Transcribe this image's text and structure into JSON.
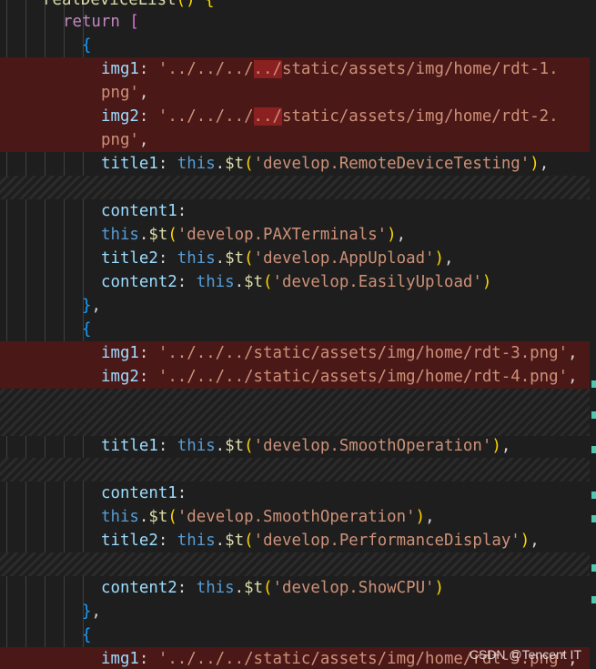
{
  "lines": {
    "l0": {
      "name": "realDeviceList",
      "parens": "()",
      "brace": "{"
    },
    "l1": {
      "kw": "return",
      "bracket": "["
    },
    "l2": {
      "brace": "{"
    },
    "l3": {
      "key": "img1",
      "colon": ": ",
      "s1": "'../../../",
      "s2": "../",
      "s3": "static/assets/img/home/rdt-1."
    },
    "l4": {
      "s1": "png'",
      "comma": ","
    },
    "l5": {
      "key": "img2",
      "colon": ": ",
      "s1": "'../../../",
      "s2": "../",
      "s3": "static/assets/img/home/rdt-2."
    },
    "l6": {
      "s1": "png'",
      "comma": ","
    },
    "l7": {
      "key": "title1",
      "colon": ": ",
      "this": "this",
      "dot": ".",
      "fn": "$t",
      "po": "(",
      "str": "'develop.RemoteDeviceTesting'",
      "pc": ")",
      "comma": ","
    },
    "l8": {
      "key": "content1",
      "colon": ":"
    },
    "l9": {
      "this": "this",
      "dot": ".",
      "fn": "$t",
      "po": "(",
      "str": "'develop.PAXTerminals'",
      "pc": ")",
      "comma": ","
    },
    "l10": {
      "key": "title2",
      "colon": ": ",
      "this": "this",
      "dot": ".",
      "fn": "$t",
      "po": "(",
      "str": "'develop.AppUpload'",
      "pc": ")",
      "comma": ","
    },
    "l11": {
      "key": "content2",
      "colon": ": ",
      "this": "this",
      "dot": ".",
      "fn": "$t",
      "po": "(",
      "str": "'develop.EasilyUpload'",
      "pc": ")"
    },
    "l12": {
      "brace": "}",
      "comma": ","
    },
    "l13": {
      "brace": "{"
    },
    "l14": {
      "key": "img1",
      "colon": ": ",
      "str": "'../../../static/assets/img/home/rdt-3.png'",
      "comma": ","
    },
    "l15": {
      "key": "img2",
      "colon": ": ",
      "str": "'../../../static/assets/img/home/rdt-4.png'",
      "comma": ","
    },
    "l16": {
      "key": "title1",
      "colon": ": ",
      "this": "this",
      "dot": ".",
      "fn": "$t",
      "po": "(",
      "str": "'develop.SmoothOperation'",
      "pc": ")",
      "comma": ","
    },
    "l17": {
      "key": "content1",
      "colon": ":"
    },
    "l18": {
      "this": "this",
      "dot": ".",
      "fn": "$t",
      "po": "(",
      "str": "'develop.SmoothOperation'",
      "pc": ")",
      "comma": ","
    },
    "l19": {
      "key": "title2",
      "colon": ": ",
      "this": "this",
      "dot": ".",
      "fn": "$t",
      "po": "(",
      "str": "'develop.PerformanceDisplay'",
      "pc": ")",
      "comma": ","
    },
    "l20": {
      "key": "content2",
      "colon": ": ",
      "this": "this",
      "dot": ".",
      "fn": "$t",
      "po": "(",
      "str": "'develop.ShowCPU'",
      "pc": ")"
    },
    "l21": {
      "brace": "}",
      "comma": ","
    },
    "l22": {
      "brace": "{"
    },
    "l23": {
      "key": "img1",
      "colon": ": ",
      "str": "'../../../static/assets/img/home/rdt-5.png'",
      "comma": ","
    }
  },
  "watermark": "CSDN @Tencent IT",
  "colors": {
    "background": "#1e1e1e",
    "removed_line": "#4b1818",
    "removed_char": "#8a2020",
    "string": "#ce9178",
    "property": "#9cdcfe",
    "keyword": "#c586c0",
    "this": "#569cd6",
    "function": "#dcdcaa"
  }
}
